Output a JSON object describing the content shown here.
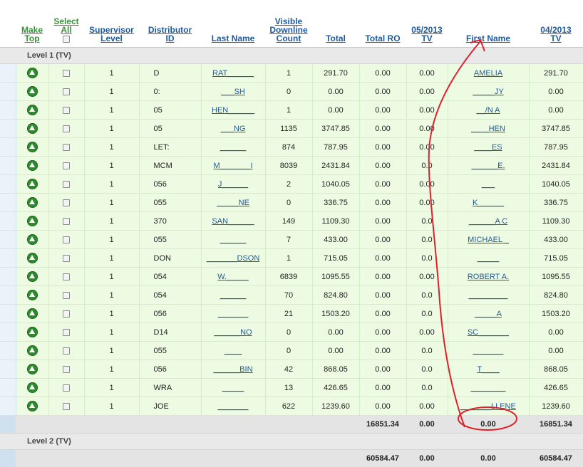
{
  "columns": [
    {
      "label_1": "",
      "label_2": "",
      "label_3": ""
    },
    {
      "label_1": "Make",
      "label_2": "Top",
      "label_3": ""
    },
    {
      "label_1": "Select",
      "label_2": "All",
      "label_3": ""
    },
    {
      "label_1": "Supervisor",
      "label_2": "Level",
      "label_3": ""
    },
    {
      "label_1": "Distributor",
      "label_2": "ID",
      "label_3": ""
    },
    {
      "label_1": "Last Name",
      "label_2": "",
      "label_3": ""
    },
    {
      "label_1": "Visible",
      "label_2": "Downline",
      "label_3": "Count"
    },
    {
      "label_1": "Total",
      "label_2": "",
      "label_3": ""
    },
    {
      "label_1": "Total RO",
      "label_2": "",
      "label_3": ""
    },
    {
      "label_1": "05/2013",
      "label_2": "TV",
      "label_3": ""
    },
    {
      "label_1": "First Name",
      "label_2": "",
      "label_3": ""
    },
    {
      "label_1": "04/2013",
      "label_2": "TV",
      "label_3": ""
    }
  ],
  "levels": [
    "Level 1 (TV)",
    "Level 2 (TV)"
  ],
  "rows": [
    {
      "level": "1",
      "dist_id": "D",
      "last_name": "RAT______",
      "count": "1",
      "total": "291.70",
      "total_ro": "0.00",
      "tv_0513": "0.00",
      "first_name": "AMELIA",
      "tv_0413": "291.70"
    },
    {
      "level": "1",
      "dist_id": "0:",
      "last_name": "___SH",
      "count": "0",
      "total": "0.00",
      "total_ro": "0.00",
      "tv_0513": "0.00",
      "first_name": "_____JY",
      "tv_0413": "0.00"
    },
    {
      "level": "1",
      "dist_id": "05",
      "last_name": "HEN______",
      "count": "1",
      "total": "0.00",
      "total_ro": "0.00",
      "tv_0513": "0.00",
      "first_name": "__/N A",
      "tv_0413": "0.00"
    },
    {
      "level": "1",
      "dist_id": "05",
      "last_name": "___NG",
      "count": "1135",
      "total": "3747.85",
      "total_ro": "0.00",
      "tv_0513": "0.00",
      "first_name": "____HEN",
      "tv_0413": "3747.85"
    },
    {
      "level": "1",
      "dist_id": "LET:",
      "last_name": "______",
      "count": "874",
      "total": "787.95",
      "total_ro": "0.00",
      "tv_0513": "0.00",
      "first_name": "____ES",
      "tv_0413": "787.95"
    },
    {
      "level": "1",
      "dist_id": "MCM",
      "last_name": "M_______I",
      "count": "8039",
      "total": "2431.84",
      "total_ro": "0.00",
      "tv_0513": "0.0",
      "first_name": "______E.",
      "tv_0413": "2431.84"
    },
    {
      "level": "1",
      "dist_id": "056",
      "last_name": "J______",
      "count": "2",
      "total": "1040.05",
      "total_ro": "0.00",
      "tv_0513": "0.00",
      "first_name": "___",
      "tv_0413": "1040.05"
    },
    {
      "level": "1",
      "dist_id": "055",
      "last_name": "_____NE",
      "count": "0",
      "total": "336.75",
      "total_ro": "0.00",
      "tv_0513": "0.00",
      "first_name": "K______",
      "tv_0413": "336.75"
    },
    {
      "level": "1",
      "dist_id": "370",
      "last_name": "SAN______",
      "count": "149",
      "total": "1109.30",
      "total_ro": "0.00",
      "tv_0513": "0.0",
      "first_name": "______A C",
      "tv_0413": "1109.30"
    },
    {
      "level": "1",
      "dist_id": "055",
      "last_name": "______",
      "count": "7",
      "total": "433.00",
      "total_ro": "0.00",
      "tv_0513": "0.0",
      "first_name": "MICHAEL _",
      "tv_0413": "433.00"
    },
    {
      "level": "1",
      "dist_id": "DON",
      "last_name": "_______DSON",
      "count": "1",
      "total": "715.05",
      "total_ro": "0.00",
      "tv_0513": "0.0",
      "first_name": "_____",
      "tv_0413": "715.05"
    },
    {
      "level": "1",
      "dist_id": "054",
      "last_name": "W._____",
      "count": "6839",
      "total": "1095.55",
      "total_ro": "0.00",
      "tv_0513": "0.00",
      "first_name": "ROBERT A.",
      "tv_0413": "1095.55"
    },
    {
      "level": "1",
      "dist_id": "054",
      "last_name": "______",
      "count": "70",
      "total": "824.80",
      "total_ro": "0.00",
      "tv_0513": "0.0",
      "first_name": "_________",
      "tv_0413": "824.80"
    },
    {
      "level": "1",
      "dist_id": "056",
      "last_name": "_______",
      "count": "21",
      "total": "1503.20",
      "total_ro": "0.00",
      "tv_0513": "0.0",
      "first_name": "_____A",
      "tv_0413": "1503.20"
    },
    {
      "level": "1",
      "dist_id": "D14",
      "last_name": "______NO",
      "count": "0",
      "total": "0.00",
      "total_ro": "0.00",
      "tv_0513": "0.00",
      "first_name": "SC_______",
      "tv_0413": "0.00"
    },
    {
      "level": "1",
      "dist_id": "055",
      "last_name": "____",
      "count": "0",
      "total": "0.00",
      "total_ro": "0.00",
      "tv_0513": "0.0",
      "first_name": "_______",
      "tv_0413": "0.00"
    },
    {
      "level": "1",
      "dist_id": "056",
      "last_name": "______BIN",
      "count": "42",
      "total": "868.05",
      "total_ro": "0.00",
      "tv_0513": "0.0",
      "first_name": "T____",
      "tv_0413": "868.05"
    },
    {
      "level": "1",
      "dist_id": "WRA",
      "last_name": "_____",
      "count": "13",
      "total": "426.65",
      "total_ro": "0.00",
      "tv_0513": "0.0",
      "first_name": "________",
      "tv_0413": "426.65"
    },
    {
      "level": "1",
      "dist_id": "JOE",
      "last_name": "_______",
      "count": "622",
      "total": "1239.60",
      "total_ro": "0.00",
      "tv_0513": "0.00",
      "first_name": "_______LLENE",
      "tv_0413": "1239.60"
    }
  ],
  "totals": [
    {
      "total_ro": "16851.34",
      "tv_0513": "0.00",
      "first_name": "0.00",
      "tv_0413": "16851.34"
    },
    {
      "total_ro": "60584.47",
      "tv_0513": "0.00",
      "first_name": "0.00",
      "tv_0413": "60584.47"
    }
  ],
  "colors": {
    "row_bg": "#eefbe3",
    "link": "#1f5a9c",
    "green_header": "#3a8f3a",
    "annotation": "#e0202a"
  },
  "icons": {
    "make_top": "up-arrow-circle-icon",
    "select": "checkbox"
  }
}
